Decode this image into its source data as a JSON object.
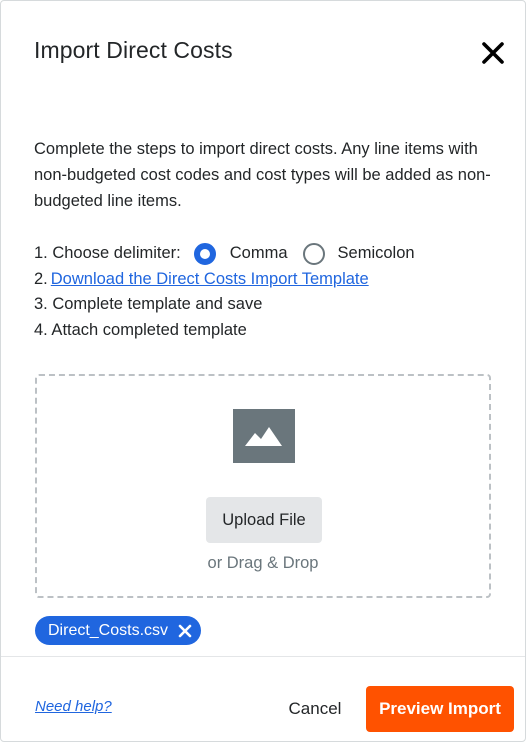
{
  "modal": {
    "title": "Import Direct Costs",
    "description": "Complete the steps to import direct costs. Any line items with non-budgeted cost codes and cost types will be added as non-budgeted line items."
  },
  "steps": {
    "step1_label": "1. Choose delimiter:",
    "delimiter_options": [
      "Comma",
      "Semicolon"
    ],
    "delimiter_selected": "Comma",
    "step2_prefix": "2.",
    "step2_link": "Download the Direct Costs Import Template",
    "step3": "3. Complete template and save",
    "step4": "4. Attach completed template"
  },
  "dropzone": {
    "upload_label": "Upload File",
    "drag_text": "or Drag & Drop",
    "icon": "image-placeholder-icon"
  },
  "attached_file": {
    "name": "Direct_Costs.csv"
  },
  "footer": {
    "help_label": "Need help?",
    "cancel_label": "Cancel",
    "primary_label": "Preview Import"
  },
  "colors": {
    "accent_blue": "#2066df",
    "primary_orange": "#ff5200",
    "text_dark": "#232628",
    "text_muted": "#6a767c",
    "dropzone_border": "#bcc1c5",
    "upload_button_bg": "#e4e6e8"
  }
}
